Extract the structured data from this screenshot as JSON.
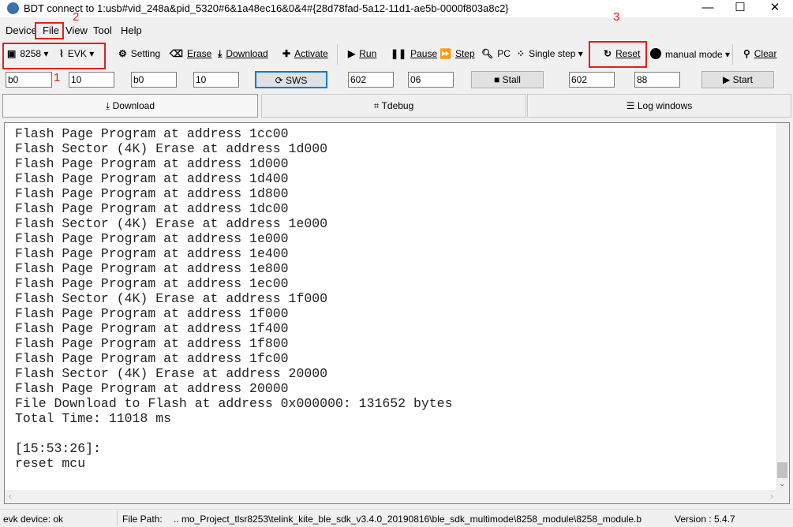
{
  "window": {
    "title": "BDT connect to 1:usb#vid_248a&pid_5320#6&1a48ec16&0&4#{28d78fad-5a12-11d1-ae5b-0000f803a8c2}",
    "minimize": "—",
    "maximize": "☐",
    "close": "✕"
  },
  "menu": [
    "Device",
    "File",
    "View",
    "Tool",
    "Help"
  ],
  "toolbar": {
    "chip": "8258",
    "board": "EVK",
    "setting": "Setting",
    "erase": "Erase",
    "download": "Download",
    "activate": "Activate",
    "run": "Run",
    "pause": "Pause",
    "step": "Step",
    "pc": "PC",
    "single_step": "Single step",
    "reset": "Reset",
    "mode": "manual mode",
    "clear": "Clear"
  },
  "inputs": {
    "f1": "b0",
    "f2": "10",
    "f3": "b0",
    "f4": "10",
    "sws": "SWS",
    "f5": "602",
    "f6": "06",
    "stall": "Stall",
    "f7": "602",
    "f8": "88",
    "start": "Start"
  },
  "tabs": [
    {
      "label": "Download",
      "selected": true
    },
    {
      "label": "Tdebug"
    },
    {
      "label": "Log windows"
    }
  ],
  "log": [
    "Flash Page Program at address 1cc00",
    "Flash Sector (4K) Erase at address 1d000",
    "Flash Page Program at address 1d000",
    "Flash Page Program at address 1d400",
    "Flash Page Program at address 1d800",
    "Flash Page Program at address 1dc00",
    "Flash Sector (4K) Erase at address 1e000",
    "Flash Page Program at address 1e000",
    "Flash Page Program at address 1e400",
    "Flash Page Program at address 1e800",
    "Flash Page Program at address 1ec00",
    "Flash Sector (4K) Erase at address 1f000",
    "Flash Page Program at address 1f000",
    "Flash Page Program at address 1f400",
    "Flash Page Program at address 1f800",
    "Flash Page Program at address 1fc00",
    "Flash Sector (4K) Erase at address 20000",
    "Flash Page Program at address 20000",
    "File Download to Flash at address 0x000000: 131652 bytes",
    "Total Time: 11018 ms",
    "",
    "[15:53:26]:",
    "reset mcu"
  ],
  "annotations": [
    "1",
    "2",
    "3"
  ],
  "status": {
    "device": "evk device: ok",
    "path_label": "File Path:",
    "path": "..  mo_Project_tlsr8253\\telink_kite_ble_sdk_v3.4.0_20190816\\ble_sdk_multimode\\8258_module\\8258_module.b",
    "version": "Version : 5.4.7"
  },
  "colors": {
    "annotation": "#e02020",
    "sws_border": "#0078d7"
  }
}
